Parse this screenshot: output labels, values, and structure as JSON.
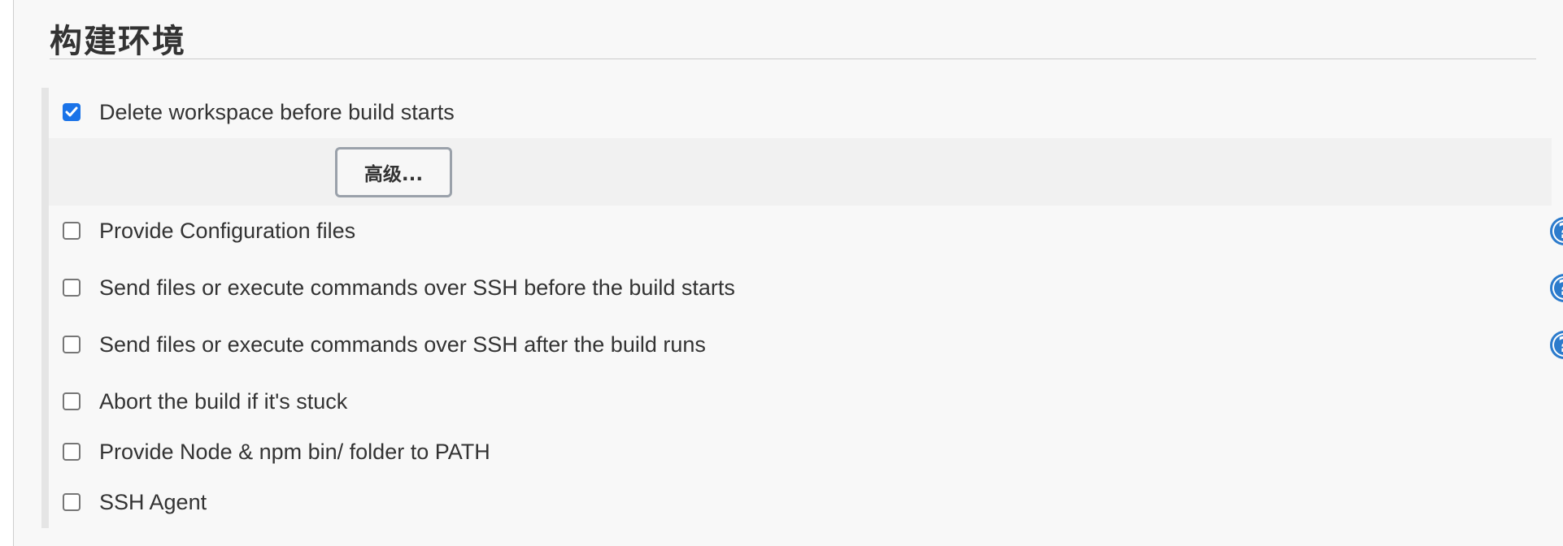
{
  "section": {
    "title": "构建环境"
  },
  "advanced_button": {
    "label": "高级..."
  },
  "options": [
    {
      "label": "Delete workspace before build starts",
      "checked": true,
      "has_help": false
    },
    {
      "label": "Provide Configuration files",
      "checked": false,
      "has_help": true
    },
    {
      "label": "Send files or execute commands over SSH before the build starts",
      "checked": false,
      "has_help": true
    },
    {
      "label": "Send files or execute commands over SSH after the build runs",
      "checked": false,
      "has_help": true
    },
    {
      "label": "Abort the build if it's stuck",
      "checked": false,
      "has_help": false
    },
    {
      "label": "Provide Node & npm bin/ folder to PATH",
      "checked": false,
      "has_help": false
    },
    {
      "label": "SSH Agent",
      "checked": false,
      "has_help": false
    }
  ],
  "help_icon": {
    "glyph": "?"
  },
  "colors": {
    "accent": "#1a73e8",
    "help": "#2c7bcc"
  }
}
